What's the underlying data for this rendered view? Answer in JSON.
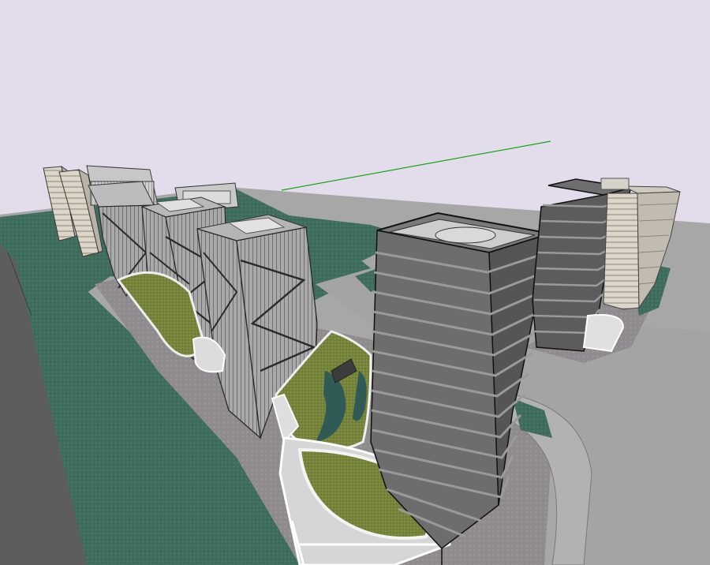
{
  "scene": {
    "type": "3D architectural massing model",
    "colors": {
      "sky": "#e3dcea",
      "horizon_band": "#a9a9a9",
      "ground_green": "#3f6d5e",
      "ground_green_light": "#4b7d6b",
      "pavement": "#8f8a8d",
      "road": "#a6a6a6",
      "road_dark": "#5a5a5a",
      "tower_dark": "#5c5c5c",
      "tower_light": "#d9d3c6",
      "podium": "#d8d8d8",
      "lawn": "#7a8a3a",
      "water": "#2f5a55",
      "axis_green": "#1aa51a"
    }
  }
}
